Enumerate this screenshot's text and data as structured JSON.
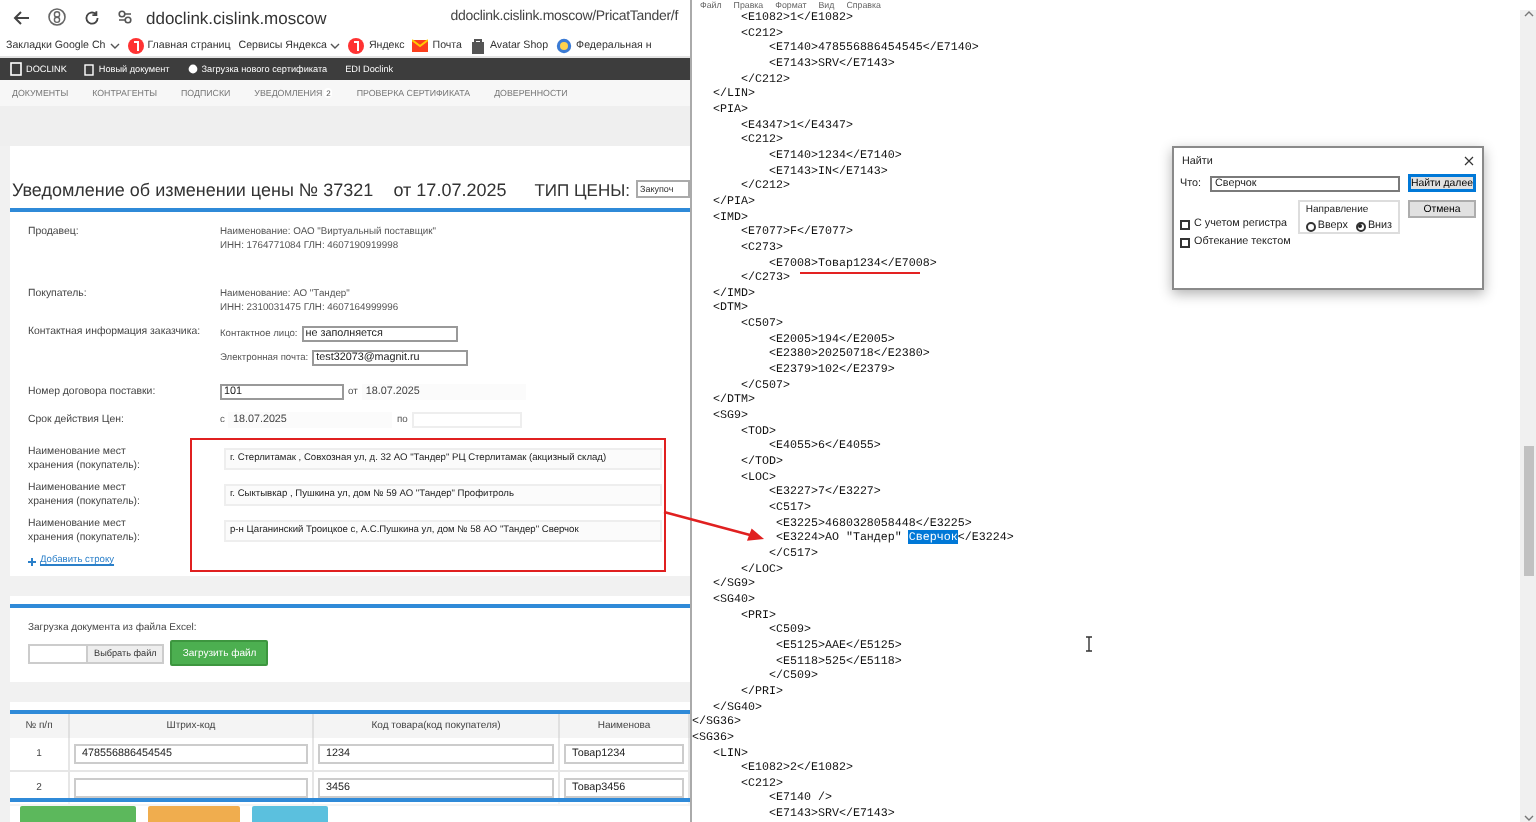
{
  "browser": {
    "url": "ddoclink.cislink.moscow",
    "page_title": "ddoclink.cislink.moscow/PricatTander/f",
    "bookmarks": [
      {
        "label": "Закладки Google Ch",
        "kind": "menu"
      },
      {
        "label": "Главная страниц",
        "kind": "yandex"
      },
      {
        "label": "Сервисы Яндекса",
        "kind": "menu"
      },
      {
        "label": "Яндекс",
        "kind": "yandex"
      },
      {
        "label": "Почта",
        "kind": "mail"
      },
      {
        "label": "Avatar Shop",
        "kind": "shop"
      },
      {
        "label": "Федеральная н",
        "kind": "globe"
      }
    ]
  },
  "app_bar": {
    "logo": "DOCLINK",
    "items": [
      {
        "label": "Новый документ",
        "kind": "doc"
      },
      {
        "label": "Загрузка нового сертификата",
        "kind": "dot"
      },
      {
        "label": "EDI Doclink",
        "kind": "text"
      }
    ]
  },
  "nav": [
    {
      "label": "ДОКУМЕНТЫ"
    },
    {
      "label": "КОНТРАГЕНТЫ"
    },
    {
      "label": "ПОДПИСКИ"
    },
    {
      "label": "УВЕДОМЛЕНИЯ",
      "badge": "2"
    },
    {
      "label": "ПРОВЕРКА СЕРТИФИКАТА"
    },
    {
      "label": "ДОВЕРЕННОСТИ"
    }
  ],
  "notice": {
    "title": "Уведомление об изменении цены № 37321",
    "date": "от 17.07.2025",
    "price_type_label": "ТИП ЦЕНЫ:",
    "price_type": "Закупоч"
  },
  "parties": [
    {
      "label": "Продавец:",
      "name": "Наименование: ОАО \"Виртуальный поставщик\"",
      "ids": "ИНН: 1764771084 ГЛН: 4607190919998"
    },
    {
      "label": "Покупатель:",
      "name": "Наименование: АО \"Тандер\"",
      "ids": "ИНН: 2310031475 ГЛН: 4607164999996"
    }
  ],
  "contact": {
    "label": "Контактная информация заказчика:",
    "fields": [
      {
        "label": "Контактное лицо:",
        "value": "не заполняется"
      },
      {
        "label": "Электронная почта:",
        "value": "test32073@magnit.ru"
      }
    ]
  },
  "contract": {
    "label": "Номер договора поставки:",
    "number": "101",
    "date_label": "от",
    "date": "18.07.2025"
  },
  "validity": {
    "label": "Срок действия Цен:",
    "from_label": "с",
    "from": "18.07.2025",
    "to_label": "по"
  },
  "storage": [
    {
      "label": "Наименование мест хранения (покупатель):",
      "value": "г. Стерлитамак , Совхозная ул, д. 32 АО \"Тандер\" РЦ Стерлитамак (акцизный склад)"
    },
    {
      "label": "Наименование мест хранения (покупатель):",
      "value": "г. Сыктывкар , Пушкина ул, дом № 59 АО \"Тандер\" Профитроль"
    },
    {
      "label": "Наименование мест хранения (покупатель):",
      "value": "р-н Цаганинский  Троицкое с, А.С.Пушкина ул, дом № 58 АО \"Тандер\" Сверчок"
    }
  ],
  "add_row": "Добавить строку",
  "excel": {
    "label": "Загрузка документа из файла Excel:",
    "choose": "Выбрать файл",
    "upload": "Загрузить файл"
  },
  "table": {
    "columns": [
      "№ п/п",
      "Штрих-код",
      "Код товара(код покупателя)",
      "Наименова"
    ],
    "rows": [
      {
        "number": "1",
        "barcode": "478556886454545",
        "code": "1234",
        "name": "Товар1234"
      },
      {
        "number": "2",
        "code": "3456",
        "name": "Товар3456"
      }
    ]
  },
  "bottom_buttons": [
    {
      "color": "#5cb85c"
    },
    {
      "color": "#f0ad4e"
    },
    {
      "color": "#5bc0de"
    }
  ],
  "notepad": {
    "menu": [
      "Файл",
      "Правка",
      "Формат",
      "Вид",
      "Справка"
    ],
    "lines": [
      {
        "text": "       <E1082>1</E1082>",
        "kind": "plain"
      },
      {
        "text": "       <C212>",
        "kind": "plain"
      },
      {
        "text": "           <E7140>478556886454545</E7140>",
        "kind": "plain"
      },
      {
        "text": "           <E7143>SRV</E7143>",
        "kind": "plain"
      },
      {
        "text": "       </C212>",
        "kind": "plain"
      },
      {
        "text": "   </LIN>",
        "kind": "plain"
      },
      {
        "text": "   <PIA>",
        "kind": "plain"
      },
      {
        "text": "       <E4347>1</E4347>",
        "kind": "plain"
      },
      {
        "text": "       <C212>",
        "kind": "plain"
      },
      {
        "text": "           <E7140>1234</E7140>",
        "kind": "plain"
      },
      {
        "text": "           <E7143>IN</E7143>",
        "kind": "plain"
      },
      {
        "text": "       </C212>",
        "kind": "plain"
      },
      {
        "text": "   </PIA>",
        "kind": "plain"
      },
      {
        "text": "   <IMD>",
        "kind": "plain"
      },
      {
        "text": "       <E7077>F</E7077>",
        "kind": "plain"
      },
      {
        "text": "       <C273>",
        "kind": "plain"
      },
      {
        "text": "           <E7008>Товар1234</E7008>",
        "kind": "underlined"
      },
      {
        "text": "       </C273>",
        "kind": "plain"
      },
      {
        "text": "   </IMD>",
        "kind": "plain"
      },
      {
        "text": "   <DTM>",
        "kind": "plain"
      },
      {
        "text": "       <C507>",
        "kind": "plain"
      },
      {
        "text": "           <E2005>194</E2005>",
        "kind": "plain"
      },
      {
        "text": "           <E2380>20250718</E2380>",
        "kind": "plain"
      },
      {
        "text": "           <E2379>102</E2379>",
        "kind": "plain"
      },
      {
        "text": "       </C507>",
        "kind": "plain"
      },
      {
        "text": "   </DTM>",
        "kind": "plain"
      },
      {
        "text": "   <SG9>",
        "kind": "plain"
      },
      {
        "text": "       <TOD>",
        "kind": "plain"
      },
      {
        "text": "           <E4055>6</E4055>",
        "kind": "plain"
      },
      {
        "text": "       </TOD>",
        "kind": "plain"
      },
      {
        "text": "       <LOC>",
        "kind": "plain"
      },
      {
        "text": "           <E3227>7</E3227>",
        "kind": "plain"
      },
      {
        "text": "           <C517>",
        "kind": "plain"
      },
      {
        "text": "            <E3225>4680328058448</E3225>",
        "kind": "plain"
      },
      {
        "text": "            <E3224>АО \"Тандер\" ",
        "selected_text": "Сверчок",
        "after": "</E3224>",
        "kind": "selection"
      },
      {
        "text": "           </C517>",
        "kind": "plain"
      },
      {
        "text": "       </LOC>",
        "kind": "plain"
      },
      {
        "text": "   </SG9>",
        "kind": "plain"
      },
      {
        "text": "   <SG40>",
        "kind": "plain"
      },
      {
        "text": "       <PRI>",
        "kind": "plain"
      },
      {
        "text": "           <C509>",
        "kind": "plain"
      },
      {
        "text": "            <E5125>AAE</E5125>",
        "kind": "plain"
      },
      {
        "text": "            <E5118>525</E5118>",
        "kind": "plain"
      },
      {
        "text": "           </C509>",
        "kind": "plain"
      },
      {
        "text": "       </PRI>",
        "kind": "plain"
      },
      {
        "text": "   </SG40>",
        "kind": "plain"
      },
      {
        "text": "</SG36>",
        "kind": "plain"
      },
      {
        "text": "<SG36>",
        "kind": "plain"
      },
      {
        "text": "   <LIN>",
        "kind": "plain"
      },
      {
        "text": "       <E1082>2</E1082>",
        "kind": "plain"
      },
      {
        "text": "       <C212>",
        "kind": "plain"
      },
      {
        "text": "           <E7140 />",
        "kind": "plain"
      },
      {
        "text": "           <E7143>SRV</E7143>",
        "kind": "plain"
      }
    ]
  },
  "find_dialog": {
    "title": "Найти",
    "what_label": "Что:",
    "query": "Сверчок",
    "find_next": "Найти далее",
    "cancel": "Отмена",
    "direction_label": "Направление",
    "directions": [
      {
        "label": "Вверх",
        "selected": false
      },
      {
        "label": "Вниз",
        "selected": true
      }
    ],
    "options": [
      {
        "label": "С учетом регистра",
        "checked": false
      },
      {
        "label": "Обтекание текстом",
        "checked": false
      }
    ]
  }
}
